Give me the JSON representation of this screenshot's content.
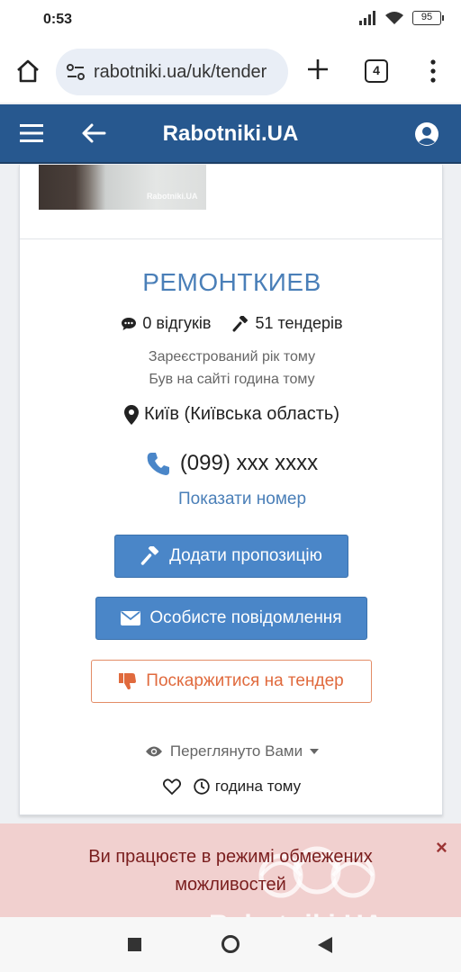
{
  "status_bar": {
    "time": "0:53",
    "battery": "95"
  },
  "browser": {
    "url": "rabotniki.ua/uk/tender",
    "tab_count": "4"
  },
  "header": {
    "title": "Rabotniki.UA"
  },
  "photo": {
    "watermark": "Rabotniki.UA"
  },
  "profile": {
    "company_name": "РЕМОНТКИЕВ",
    "reviews": "0 відгуків",
    "tenders": "51 тендерів",
    "registered": "Зареєстрований рік тому",
    "last_seen": "Був на сайті година тому",
    "location": "Київ (Київська область)",
    "phone": "(099) xxx xxxx",
    "show_number": "Показати номер"
  },
  "actions": {
    "add_offer": "Додати пропозицію",
    "private_message": "Особисте повідомлення",
    "complain": "Поскаржитися на тендер"
  },
  "views": {
    "viewed_by_you": "Переглянуто Вами",
    "time_ago": "година тому"
  },
  "banner": {
    "text": "Ви працюєте в режимі обмежених можливостей",
    "close": "×",
    "watermark": "Rabotniki.UA"
  },
  "colors": {
    "header_bg": "#27588f",
    "accent_blue": "#4a86c8",
    "link_blue": "#4a7fb8",
    "warning_orange": "#e06a3d",
    "banner_bg": "#f1d0cf"
  },
  "icons": {
    "home": "home-icon",
    "site_settings": "site-settings-icon",
    "new_tab": "plus-icon",
    "more": "more-vert-icon",
    "menu": "hamburger-icon",
    "back": "back-arrow-icon",
    "account": "user-circle-icon",
    "reviews": "comment-icon",
    "tenders": "gavel-icon",
    "location": "map-marker-icon",
    "phone": "phone-icon",
    "offer": "gavel-icon",
    "message": "envelope-icon",
    "complain": "thumbs-down-icon",
    "viewed": "eye-icon",
    "favorite": "heart-icon",
    "time": "clock-icon"
  }
}
